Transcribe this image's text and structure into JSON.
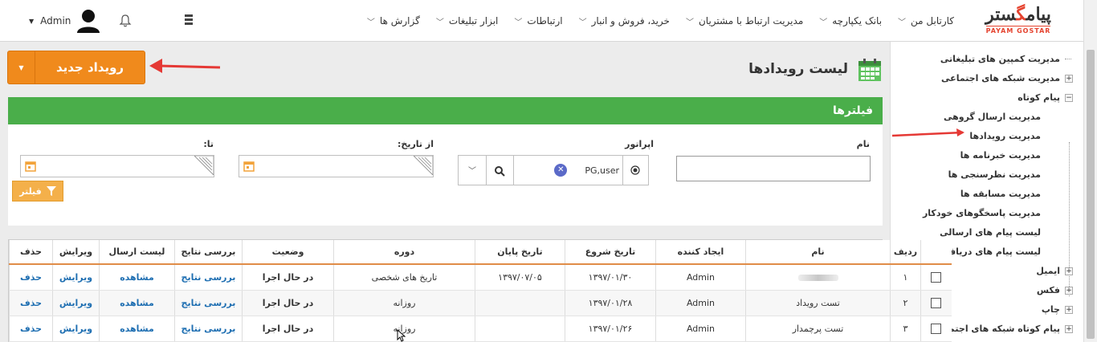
{
  "brand": {
    "name_fa": "پیام‌گستر",
    "name_en": "PAYAM GOSTAR"
  },
  "topnav": {
    "items": [
      "کارتابل من",
      "بانک یکپارچه",
      "مدیریت ارتباط با مشتریان",
      "خرید، فروش و انبار",
      "ارتباطات",
      "ابزار تبلیغات",
      "گزارش ها"
    ],
    "user": "Admin"
  },
  "sidebar": {
    "items": [
      {
        "label": "مدیریت کمپین های تبلیغاتی",
        "type": "leaf"
      },
      {
        "label": "مدیریت شبکه های اجتماعی",
        "type": "plus"
      },
      {
        "label": "پیام کوتاه",
        "type": "minus"
      },
      {
        "label": "مدیریت ارسال گروهی",
        "type": "child"
      },
      {
        "label": "مدیریت رویدادها",
        "type": "child"
      },
      {
        "label": "مدیریت خبرنامه ها",
        "type": "child"
      },
      {
        "label": "مدیریت نظرسنجی ها",
        "type": "child"
      },
      {
        "label": "مدیریت مسابقه ها",
        "type": "child"
      },
      {
        "label": "مدیریت پاسخگوهای خودکار",
        "type": "child"
      },
      {
        "label": "لیست پیام های ارسالی",
        "type": "child"
      },
      {
        "label": "لیست پیام های دریافتی",
        "type": "child"
      },
      {
        "label": "ایمیل",
        "type": "plus"
      },
      {
        "label": "فکس",
        "type": "plus"
      },
      {
        "label": "چاپ",
        "type": "plus"
      },
      {
        "label": "پیام کوتاه شبکه های اجتماعی",
        "type": "plus"
      }
    ]
  },
  "page": {
    "title": "لیست رویدادها",
    "new_button": "رویداد جدید"
  },
  "filters": {
    "title": "فیلترها",
    "name_label": "نام",
    "name_value": "",
    "operator_label": "اپراتور",
    "operator_value": "PG,user",
    "from_label": "از تاریخ:",
    "to_label": "تا:",
    "button": "فیلتر"
  },
  "table": {
    "headers": [
      "ردیف",
      "نام",
      "ایجاد کننده",
      "تاریخ شروع",
      "تاریخ پایان",
      "دوره",
      "وضعیت",
      "بررسی نتایج",
      "لیست ارسال",
      "ویرایش",
      "حذف"
    ],
    "rows": [
      {
        "idx": "۱",
        "name": "",
        "creator": "Admin",
        "start": "۱۳۹۷/۰۱/۳۰",
        "end": "۱۳۹۷/۰۷/۰۵",
        "period": "تاریخ های شخصی",
        "status": "در حال اجرا",
        "review": "بررسی نتایج",
        "list": "مشاهده",
        "edit": "ویرایش",
        "delete": "حذف"
      },
      {
        "idx": "۲",
        "name": "تست رویداد",
        "creator": "Admin",
        "start": "۱۳۹۷/۰۱/۲۸",
        "end": "",
        "period": "روزانه",
        "status": "در حال اجرا",
        "review": "بررسی نتایج",
        "list": "مشاهده",
        "edit": "ویرایش",
        "delete": "حذف"
      },
      {
        "idx": "۳",
        "name": "تست پرچمدار",
        "creator": "Admin",
        "start": "۱۳۹۷/۰۱/۲۶",
        "end": "",
        "period": "روزانه",
        "status": "در حال اجرا",
        "review": "بررسی نتایج",
        "list": "مشاهده",
        "edit": "ویرایش",
        "delete": "حذف"
      }
    ]
  },
  "colors": {
    "accent_orange": "#f08a1c",
    "green": "#4aae4a",
    "link": "#1f6fb2",
    "arrow_red": "#e53935"
  }
}
